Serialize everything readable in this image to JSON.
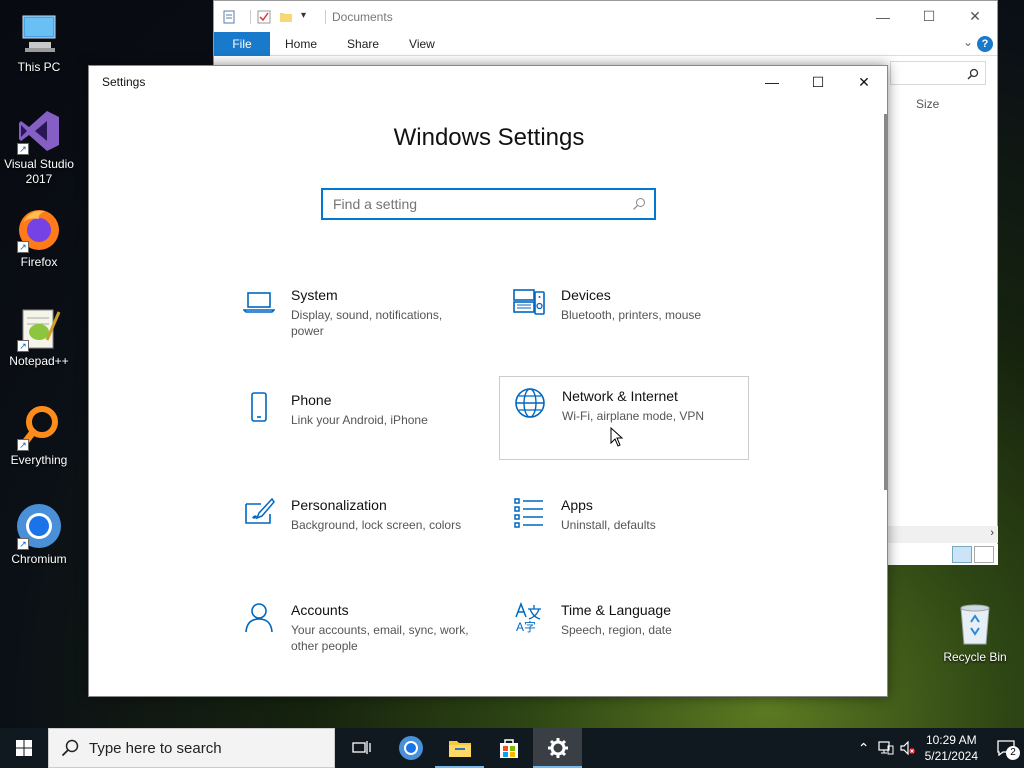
{
  "desktop": {
    "icons": [
      {
        "label": "This PC"
      },
      {
        "label": "Visual Studio 2017"
      },
      {
        "label": "Firefox"
      },
      {
        "label": "Notepad++"
      },
      {
        "label": "Everything"
      },
      {
        "label": "Chromium"
      }
    ],
    "recycle_bin": "Recycle Bin"
  },
  "explorer": {
    "title": "Documents",
    "ribbon_tabs": [
      "File",
      "Home",
      "Share",
      "View"
    ],
    "column_size": "Size"
  },
  "settings": {
    "title": "Settings",
    "heading": "Windows Settings",
    "search_placeholder": "Find a setting",
    "categories": [
      {
        "name": "System",
        "desc": "Display, sound, notifications, power",
        "icon": "laptop-icon"
      },
      {
        "name": "Devices",
        "desc": "Bluetooth, printers, mouse",
        "icon": "keyboard-speaker-icon"
      },
      {
        "name": "Phone",
        "desc": "Link your Android, iPhone",
        "icon": "phone-icon"
      },
      {
        "name": "Network & Internet",
        "desc": "Wi-Fi, airplane mode, VPN",
        "icon": "globe-icon"
      },
      {
        "name": "Personalization",
        "desc": "Background, lock screen, colors",
        "icon": "paintbrush-icon"
      },
      {
        "name": "Apps",
        "desc": "Uninstall, defaults",
        "icon": "apps-list-icon"
      },
      {
        "name": "Accounts",
        "desc": "Your accounts, email, sync, work, other people",
        "icon": "person-icon"
      },
      {
        "name": "Time & Language",
        "desc": "Speech, region, date",
        "icon": "time-language-icon"
      }
    ],
    "accent": "#0067c0"
  },
  "taskbar": {
    "search_placeholder": "Type here to search",
    "time": "10:29 AM",
    "date": "5/21/2024",
    "notification_count": "2"
  }
}
